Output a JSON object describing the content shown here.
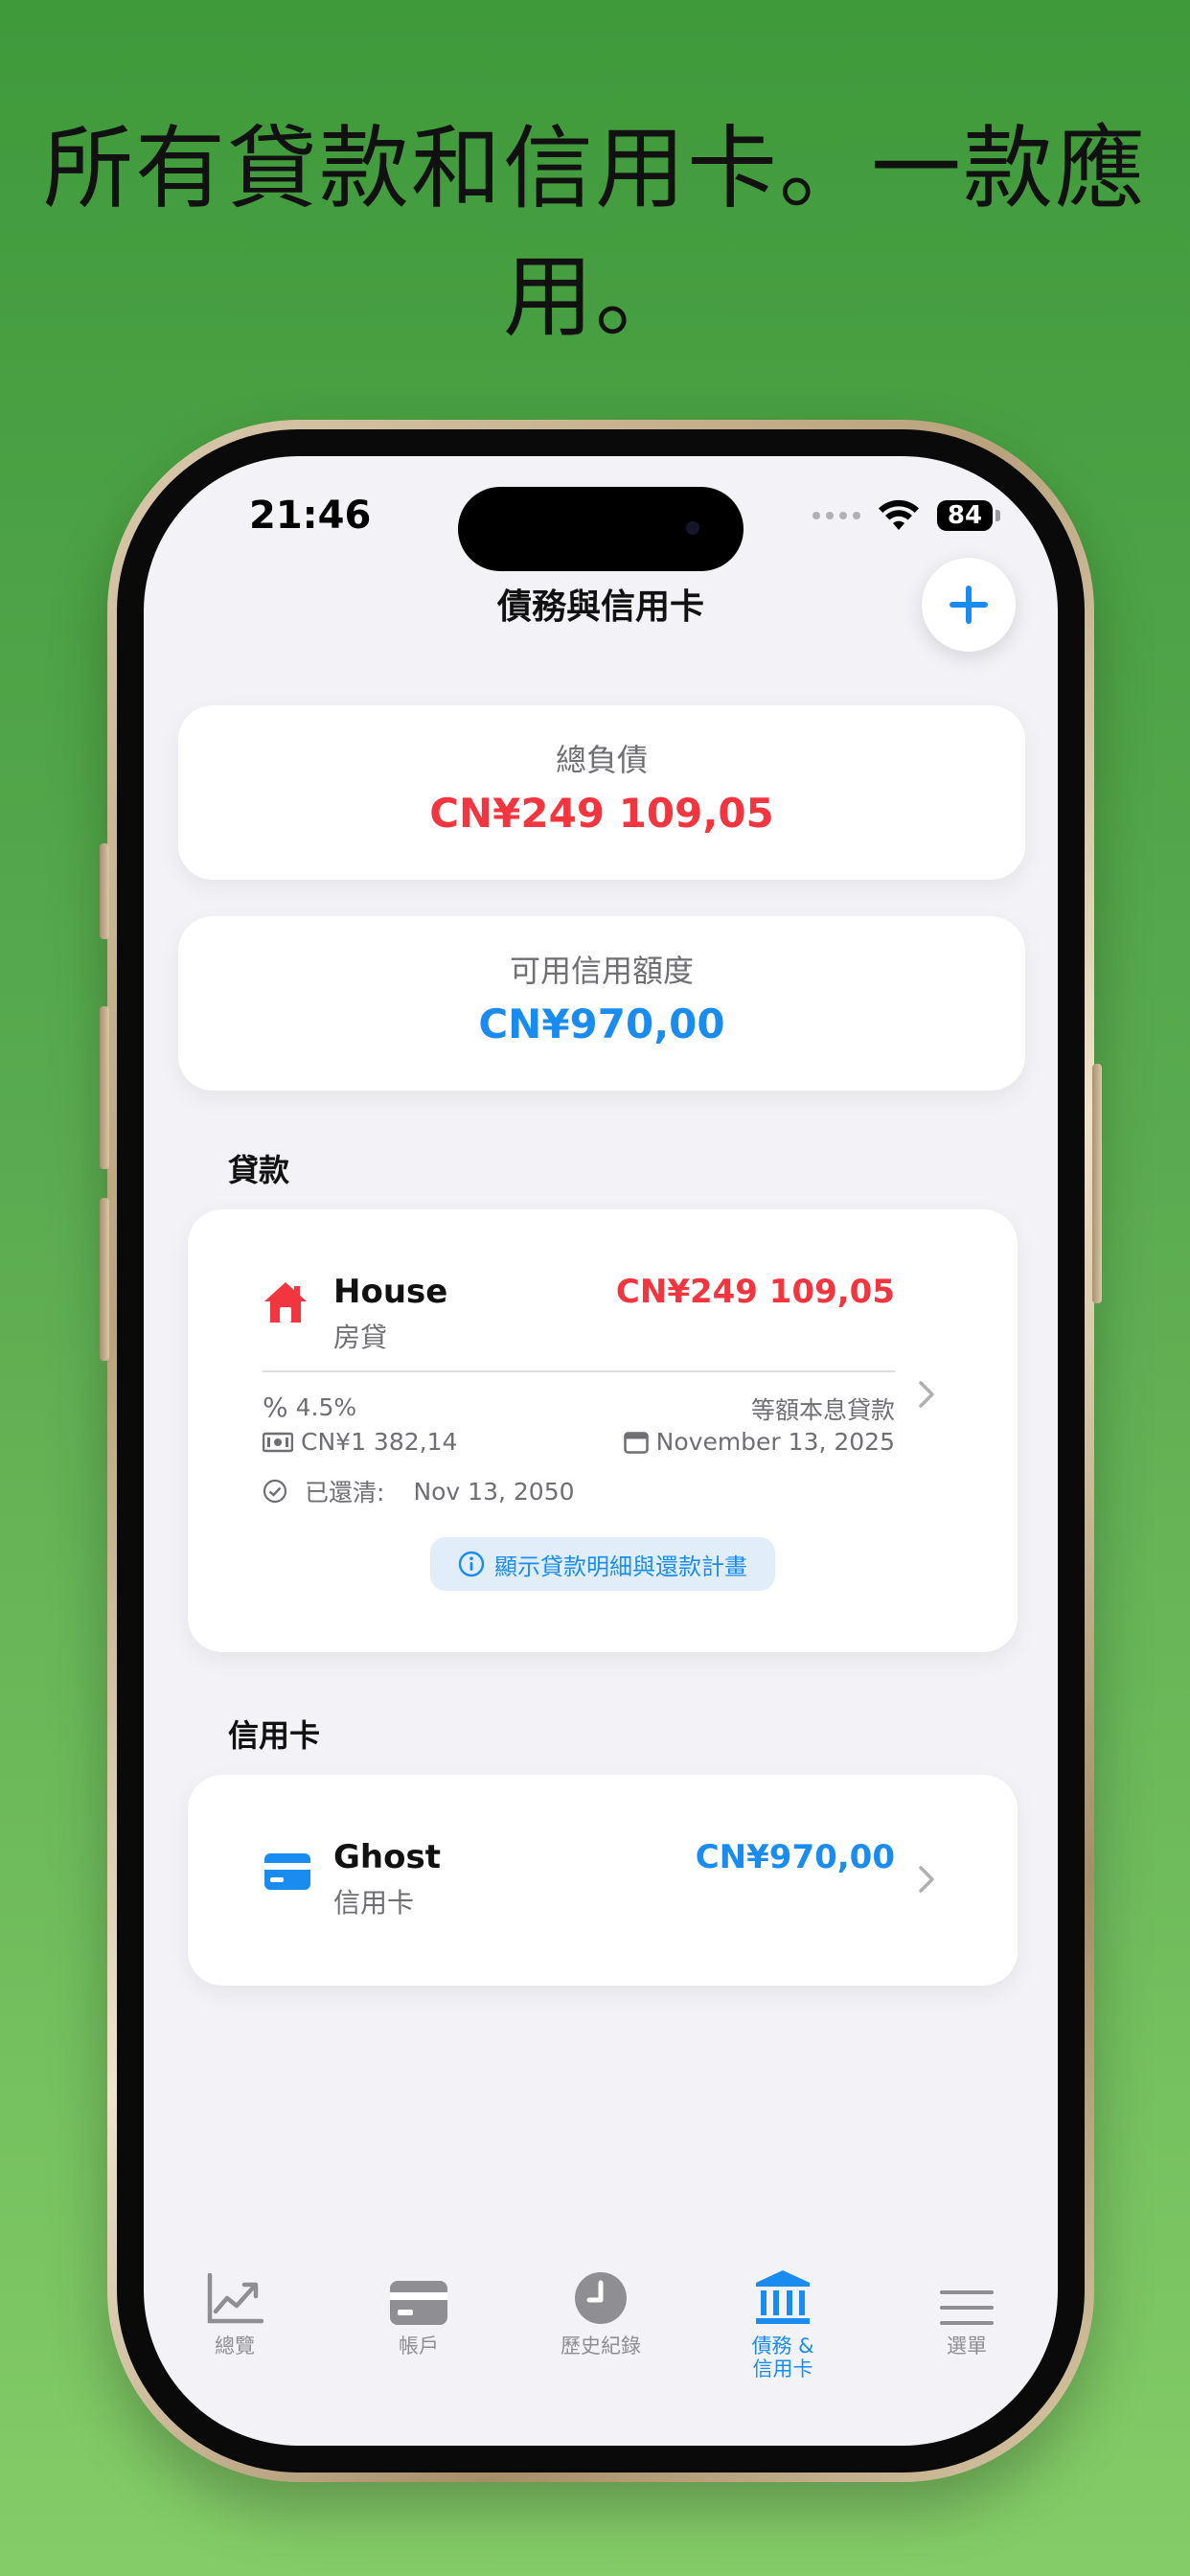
{
  "headline": "所有貸款和信用卡。一款應用。",
  "status": {
    "time": "21:46",
    "battery": "84"
  },
  "nav": {
    "title": "債務與信用卡"
  },
  "summary": {
    "total_debt_label": "總負債",
    "total_debt_value": "CN¥249 109,05",
    "available_credit_label": "可用信用額度",
    "available_credit_value": "CN¥970,00"
  },
  "loans": {
    "section_title": "貸款",
    "items": [
      {
        "name": "House",
        "type": "房貸",
        "amount": "CN¥249 109,05",
        "rate": "4.5%",
        "method": "等額本息貸款",
        "payment": "CN¥1 382,14",
        "next_date": "November 13, 2025",
        "paid_off_label": "已還清:",
        "paid_off_date": "Nov 13, 2050",
        "details_button": "顯示貸款明細與還款計畫"
      }
    ]
  },
  "credit_cards": {
    "section_title": "信用卡",
    "items": [
      {
        "name": "Ghost",
        "type": "信用卡",
        "amount": "CN¥970,00"
      }
    ]
  },
  "tabbar": {
    "items": [
      {
        "label": "總覽",
        "icon": "chart-icon"
      },
      {
        "label": "帳戶",
        "icon": "card-icon"
      },
      {
        "label": "歷史紀錄",
        "icon": "clock-icon"
      },
      {
        "label": "債務 &",
        "label2": "信用卡",
        "icon": "bank-icon"
      },
      {
        "label": "選單",
        "icon": "menu-icon"
      }
    ]
  },
  "colors": {
    "debt": "#f2353f",
    "credit": "#1a8cf0",
    "active_tab": "#1a8cf0",
    "inactive_tab": "#8e8e93"
  }
}
